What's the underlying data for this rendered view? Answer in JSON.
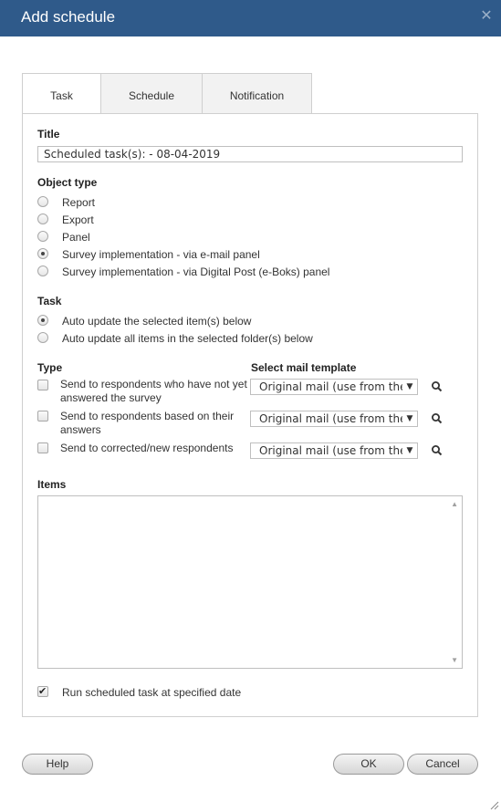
{
  "dialog": {
    "title": "Add schedule",
    "close_glyph": "✕"
  },
  "tabs": [
    {
      "label": "Task",
      "active": true
    },
    {
      "label": "Schedule",
      "active": false
    },
    {
      "label": "Notification",
      "active": false
    }
  ],
  "title_field": {
    "label": "Title",
    "value": "Scheduled task(s): - 08-04-2019"
  },
  "object_type": {
    "label": "Object type",
    "options": [
      {
        "label": "Report",
        "checked": false
      },
      {
        "label": "Export",
        "checked": false
      },
      {
        "label": "Panel",
        "checked": false
      },
      {
        "label": "Survey implementation - via e-mail panel",
        "checked": true
      },
      {
        "label": "Survey implementation - via Digital Post (e-Boks) panel",
        "checked": false
      }
    ]
  },
  "task": {
    "label": "Task",
    "options": [
      {
        "label": "Auto update the selected item(s) below",
        "checked": true
      },
      {
        "label": "Auto update all items in the selected folder(s) below",
        "checked": false
      }
    ]
  },
  "type_section": {
    "type_label": "Type",
    "template_label": "Select mail template",
    "rows": [
      {
        "line1": "Send to respondents who have not yet",
        "line2": "answered the survey",
        "checked": false,
        "template": "Original mail (use from the"
      },
      {
        "line1": "Send to respondents based on their",
        "line2": "answers",
        "checked": false,
        "template": "Original mail (use from the"
      },
      {
        "line1": "Send to corrected/new respondents",
        "line2": "",
        "checked": false,
        "template": "Original mail (use from the"
      }
    ]
  },
  "items": {
    "label": "Items"
  },
  "run_scheduled": {
    "label": "Run scheduled task at specified date",
    "checked": true
  },
  "buttons": {
    "help": "Help",
    "ok": "OK",
    "cancel": "Cancel"
  },
  "colors": {
    "titlebar": "#2f5a8a",
    "border": "#cfcfcf"
  }
}
